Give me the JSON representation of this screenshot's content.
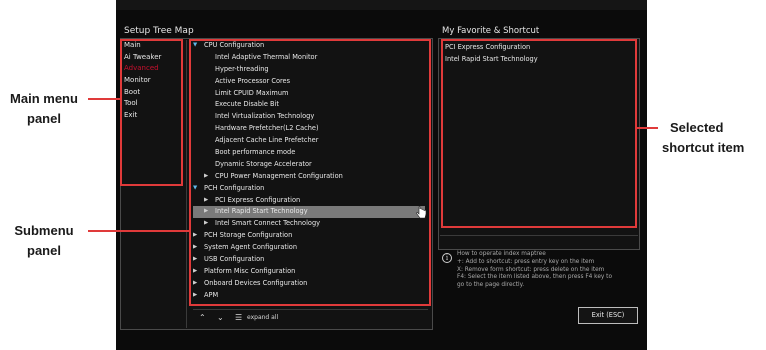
{
  "tree": {
    "title": "Setup Tree Map",
    "main_items": [
      "Main",
      "Ai Tweaker",
      "Advanced",
      "Monitor",
      "Boot",
      "Tool",
      "Exit"
    ],
    "submenu": [
      {
        "label": "CPU Configuration",
        "mark": "▼",
        "level": 0
      },
      {
        "label": "Intel Adaptive Thermal Monitor",
        "mark": "",
        "level": 1
      },
      {
        "label": "Hyper-threading",
        "mark": "",
        "level": 1
      },
      {
        "label": "Active Processor Cores",
        "mark": "",
        "level": 1
      },
      {
        "label": "Limit CPUID Maximum",
        "mark": "",
        "level": 1
      },
      {
        "label": "Execute Disable Bit",
        "mark": "",
        "level": 1
      },
      {
        "label": "Intel Virtualization Technology",
        "mark": "",
        "level": 1
      },
      {
        "label": "Hardware Prefetcher(L2 Cache)",
        "mark": "",
        "level": 1
      },
      {
        "label": "Adjacent Cache Line Prefetcher",
        "mark": "",
        "level": 1
      },
      {
        "label": "Boot performance mode",
        "mark": "",
        "level": 1
      },
      {
        "label": "Dynamic Storage Accelerator",
        "mark": "",
        "level": 1
      },
      {
        "label": "CPU Power Management Configuration",
        "mark": "▶",
        "level": 0.5
      },
      {
        "label": "PCH Configuration",
        "mark": "▼",
        "level": 0
      },
      {
        "label": "PCI Express Configuration",
        "mark": "▶",
        "level": 0.5
      },
      {
        "label": "Intel Rapid Start Technology",
        "mark": "▶",
        "level": 0.5
      },
      {
        "label": "Intel Smart Connect Technology",
        "mark": "▶",
        "level": 0.5
      },
      {
        "label": "PCH Storage Configuration",
        "mark": "▶",
        "level": 0
      },
      {
        "label": "System Agent Configuration",
        "mark": "▶",
        "level": 0
      },
      {
        "label": "USB Configuration",
        "mark": "▶",
        "level": 0
      },
      {
        "label": "Platform Misc Configuration",
        "mark": "▶",
        "level": 0
      },
      {
        "label": "Onboard Devices Configuration",
        "mark": "▶",
        "level": 0
      },
      {
        "label": "APM",
        "mark": "▶",
        "level": 0
      }
    ],
    "expand_all_label": "expand all"
  },
  "favorites": {
    "title": "My Favorite & Shortcut",
    "items": [
      "PCI Express Configuration",
      "Intel Rapid Start Technology"
    ]
  },
  "info": {
    "lines": [
      "How to operate index maptree",
      "+: Add to shortcut: press entry key on the item",
      "X: Remove form shortcut: press delete on the item",
      "F4: Select the item listed above, then press F4 key to",
      "go to the page directly."
    ]
  },
  "exit_button": "Exit (ESC)",
  "callouts": {
    "main_menu": [
      "Main menu",
      "panel"
    ],
    "submenu": [
      "Submenu",
      "panel"
    ],
    "shortcut": [
      "Selected",
      "shortcut item"
    ]
  },
  "colors": {
    "annotation_red": "#e03a3a",
    "active_menu": "#c8102e",
    "selection": "#7a7a7a"
  }
}
